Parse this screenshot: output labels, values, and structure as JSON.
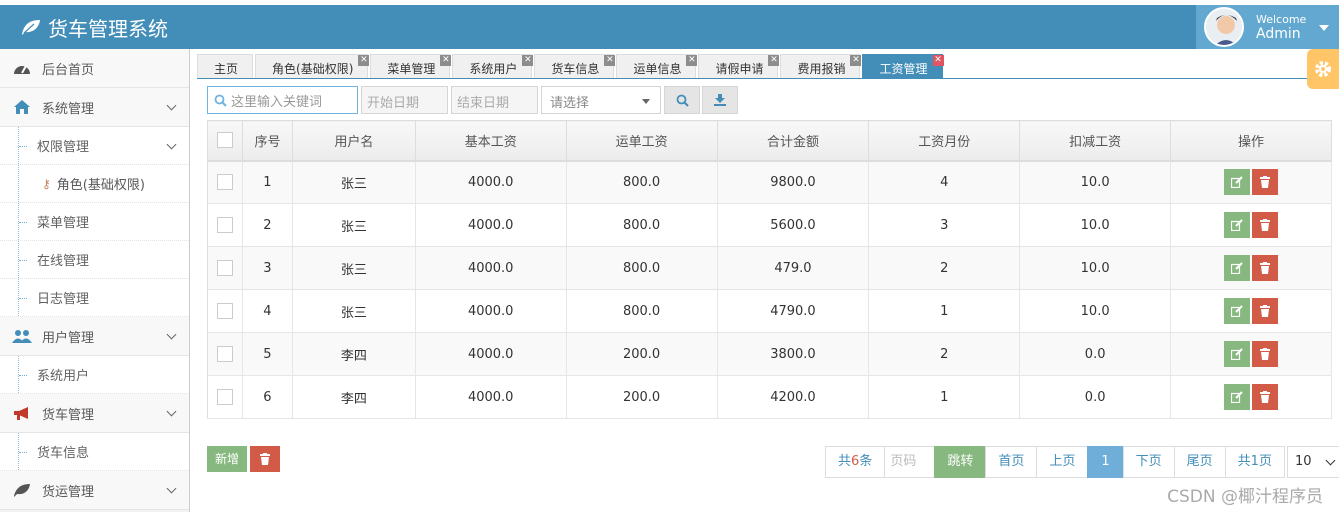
{
  "header": {
    "title": "货车管理系统",
    "welcome": "Welcome",
    "username": "Admin"
  },
  "sidebar": {
    "home": "后台首页",
    "system": "系统管理",
    "permission": "权限管理",
    "role": "角色(基础权限)",
    "menu": "菜单管理",
    "online": "在线管理",
    "log": "日志管理",
    "user_mgmt": "用户管理",
    "sys_user": "系统用户",
    "truck_mgmt": "货车管理",
    "truck_info": "货车信息",
    "freight_mgmt": "货运管理"
  },
  "tabs": [
    "主页",
    "角色(基础权限)",
    "菜单管理",
    "系统用户",
    "货车信息",
    "运单信息",
    "请假申请",
    "费用报销",
    "工资管理"
  ],
  "toolbar": {
    "search_placeholder": "这里输入关键词",
    "start_date": "开始日期",
    "end_date": "结束日期",
    "select": "请选择"
  },
  "table": {
    "headers": [
      "序号",
      "用户名",
      "基本工资",
      "运单工资",
      "合计金额",
      "工资月份",
      "扣减工资",
      "操作"
    ],
    "rows": [
      [
        "1",
        "张三",
        "4000.0",
        "800.0",
        "9800.0",
        "4",
        "10.0"
      ],
      [
        "2",
        "张三",
        "4000.0",
        "800.0",
        "5600.0",
        "3",
        "10.0"
      ],
      [
        "3",
        "张三",
        "4000.0",
        "800.0",
        "479.0",
        "2",
        "10.0"
      ],
      [
        "4",
        "张三",
        "4000.0",
        "800.0",
        "4790.0",
        "1",
        "10.0"
      ],
      [
        "5",
        "李四",
        "4000.0",
        "200.0",
        "3800.0",
        "2",
        "0.0"
      ],
      [
        "6",
        "李四",
        "4000.0",
        "200.0",
        "4200.0",
        "1",
        "0.0"
      ]
    ]
  },
  "actions": {
    "add": "新增"
  },
  "pager": {
    "total_prefix": "共",
    "total_count": "6",
    "total_suffix": "条",
    "page_input": "页码",
    "jump": "跳转",
    "first": "首页",
    "prev": "上页",
    "current": "1",
    "next": "下页",
    "last": "尾页",
    "pages": "共1页",
    "size": "10"
  },
  "watermark": "CSDN @椰汁程序员"
}
